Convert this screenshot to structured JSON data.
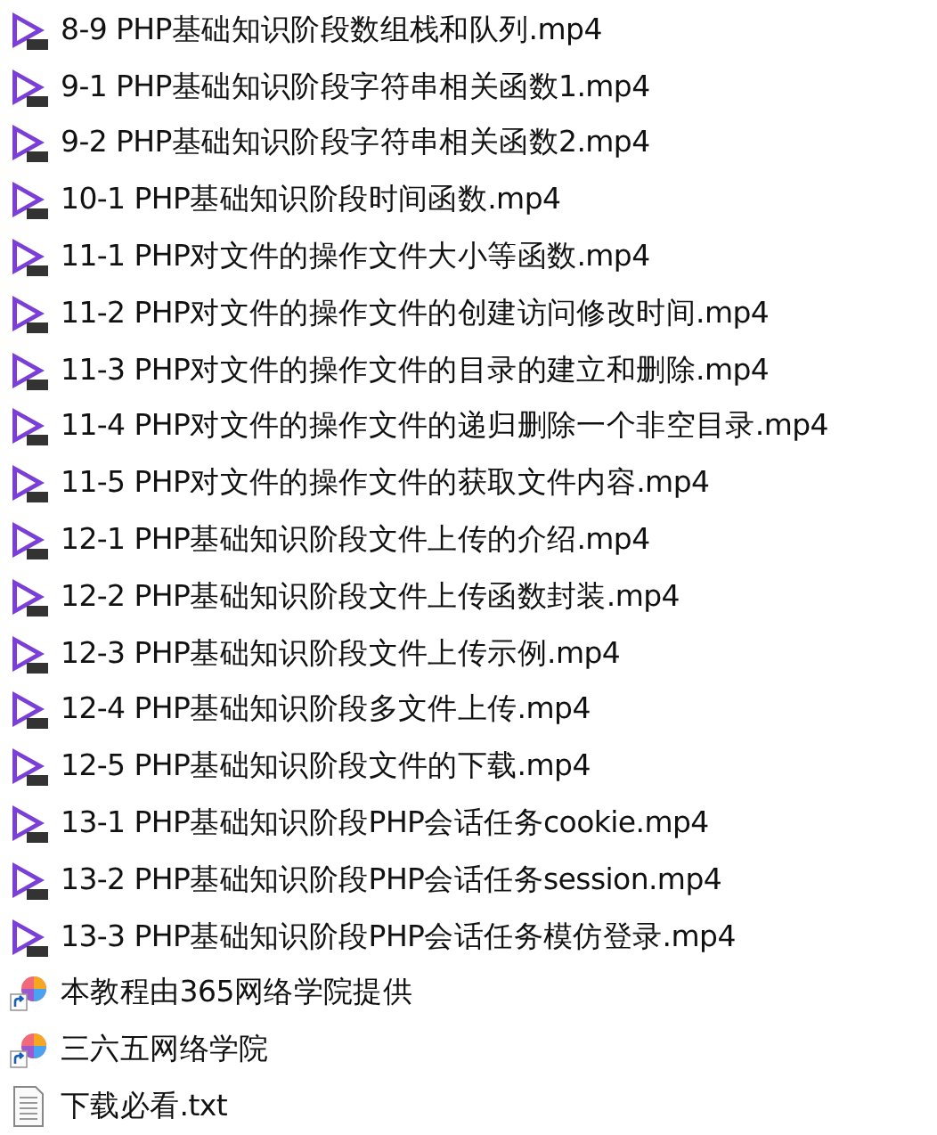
{
  "files": [
    {
      "name": "8-9 PHP基础知识阶段数组栈和队列.mp4",
      "kind": "video"
    },
    {
      "name": "9-1 PHP基础知识阶段字符串相关函数1.mp4",
      "kind": "video"
    },
    {
      "name": "9-2 PHP基础知识阶段字符串相关函数2.mp4",
      "kind": "video"
    },
    {
      "name": "10-1 PHP基础知识阶段时间函数.mp4",
      "kind": "video"
    },
    {
      "name": "11-1 PHP对文件的操作文件大小等函数.mp4",
      "kind": "video"
    },
    {
      "name": "11-2 PHP对文件的操作文件的创建访问修改时间.mp4",
      "kind": "video"
    },
    {
      "name": "11-3 PHP对文件的操作文件的目录的建立和删除.mp4",
      "kind": "video"
    },
    {
      "name": "11-4 PHP对文件的操作文件的递归删除一个非空目录.mp4",
      "kind": "video"
    },
    {
      "name": "11-5 PHP对文件的操作文件的获取文件内容.mp4",
      "kind": "video"
    },
    {
      "name": "12-1 PHP基础知识阶段文件上传的介绍.mp4",
      "kind": "video"
    },
    {
      "name": "12-2 PHP基础知识阶段文件上传函数封装.mp4",
      "kind": "video"
    },
    {
      "name": "12-3 PHP基础知识阶段文件上传示例.mp4",
      "kind": "video"
    },
    {
      "name": "12-4 PHP基础知识阶段多文件上传.mp4",
      "kind": "video"
    },
    {
      "name": "12-5 PHP基础知识阶段文件的下载.mp4",
      "kind": "video"
    },
    {
      "name": "13-1 PHP基础知识阶段PHP会话任务cookie.mp4",
      "kind": "video"
    },
    {
      "name": "13-2 PHP基础知识阶段PHP会话任务session.mp4",
      "kind": "video"
    },
    {
      "name": "13-3 PHP基础知识阶段PHP会话任务模仿登录.mp4",
      "kind": "video"
    },
    {
      "name": "本教程由365网络学院提供",
      "kind": "shortcut"
    },
    {
      "name": "三六五网络学院",
      "kind": "shortcut"
    },
    {
      "name": "下载必看.txt",
      "kind": "text"
    }
  ]
}
